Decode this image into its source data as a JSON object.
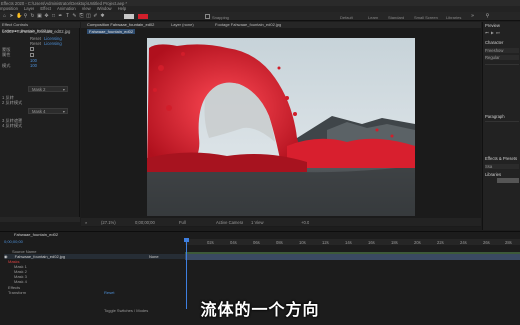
{
  "app": {
    "title": "Effects 2020 - C:\\Users\\Administrator\\Desktop\\Untitled Project.aep *"
  },
  "menu": [
    "mposition",
    "Layer",
    "Effect",
    "Animation",
    "View",
    "Window",
    "Help"
  ],
  "toolbar": {
    "snapping_label": "Snapping",
    "workspaces": [
      "Default",
      "Learn",
      "Standard",
      "Small Screen",
      "Libraries"
    ]
  },
  "project": {
    "tab_label": "Effect Controls Fahwaae_fountain_ed02.jpg",
    "layer_path": "ued02 • Fahwaae_fountain_ed02.jpg",
    "rows": [
      {
        "label": "Reset",
        "value": "Licensing"
      },
      {
        "label": "Reset",
        "value": "Licensing"
      },
      {
        "label": "蒙版",
        "value": ""
      },
      {
        "label": "属性",
        "value": ""
      },
      {
        "label": "",
        "value": "100"
      },
      {
        "label": "模式",
        "value": "100"
      }
    ],
    "mask_dropdown": "Mask 2",
    "mask_dropdown_2": "Mask 4",
    "mask_rows": [
      "1 反转",
      "2 反转模式",
      "3 反转遮罩",
      "4 反转模式"
    ]
  },
  "composition": {
    "tab_label": "Composition Fahwaae_fountain_ed02",
    "layer_tab": "Layer (none)",
    "footage_tab": "Footage Fahwaae_fountain_ed02.jpg",
    "comp_label": "Fahwaae_fountain_ed02",
    "zoom": "(27.1%)",
    "timecode": "0;00;00;00",
    "quality": "Full",
    "camera": "Active Camera",
    "view": "1 View",
    "offset": "+0.0"
  },
  "right_panel": {
    "preview_label": "Preview",
    "character_label": "Character",
    "font": "Freeshow",
    "style": "Regular",
    "paragraph_label": "Paragraph",
    "effects_label": "Effects & Presets",
    "search_placeholder": "Ssa",
    "library_label": "Libraries"
  },
  "timeline": {
    "tab_label": "Fahwaae_fountain_ed02",
    "timecode": "0;00;00;00",
    "ticks": [
      "02s",
      "04s",
      "06s",
      "08s",
      "10s",
      "12s",
      "14s",
      "16s",
      "18s",
      "20s",
      "22s",
      "24s",
      "26s",
      "28s"
    ],
    "header": "Source Name",
    "layer_name": "Fahwaae_fountain_ed02.jpg",
    "masks_label": "Masks",
    "masks": [
      "Mask 1",
      "Mask 2",
      "Mask 3",
      "Mask 4"
    ],
    "effects_label": "Effects",
    "transform_label": "Transform",
    "transform_value": "Reset",
    "mode": "None",
    "toggle": "Toggle Switches / Modes"
  },
  "subtitle": "流体的一个方向"
}
